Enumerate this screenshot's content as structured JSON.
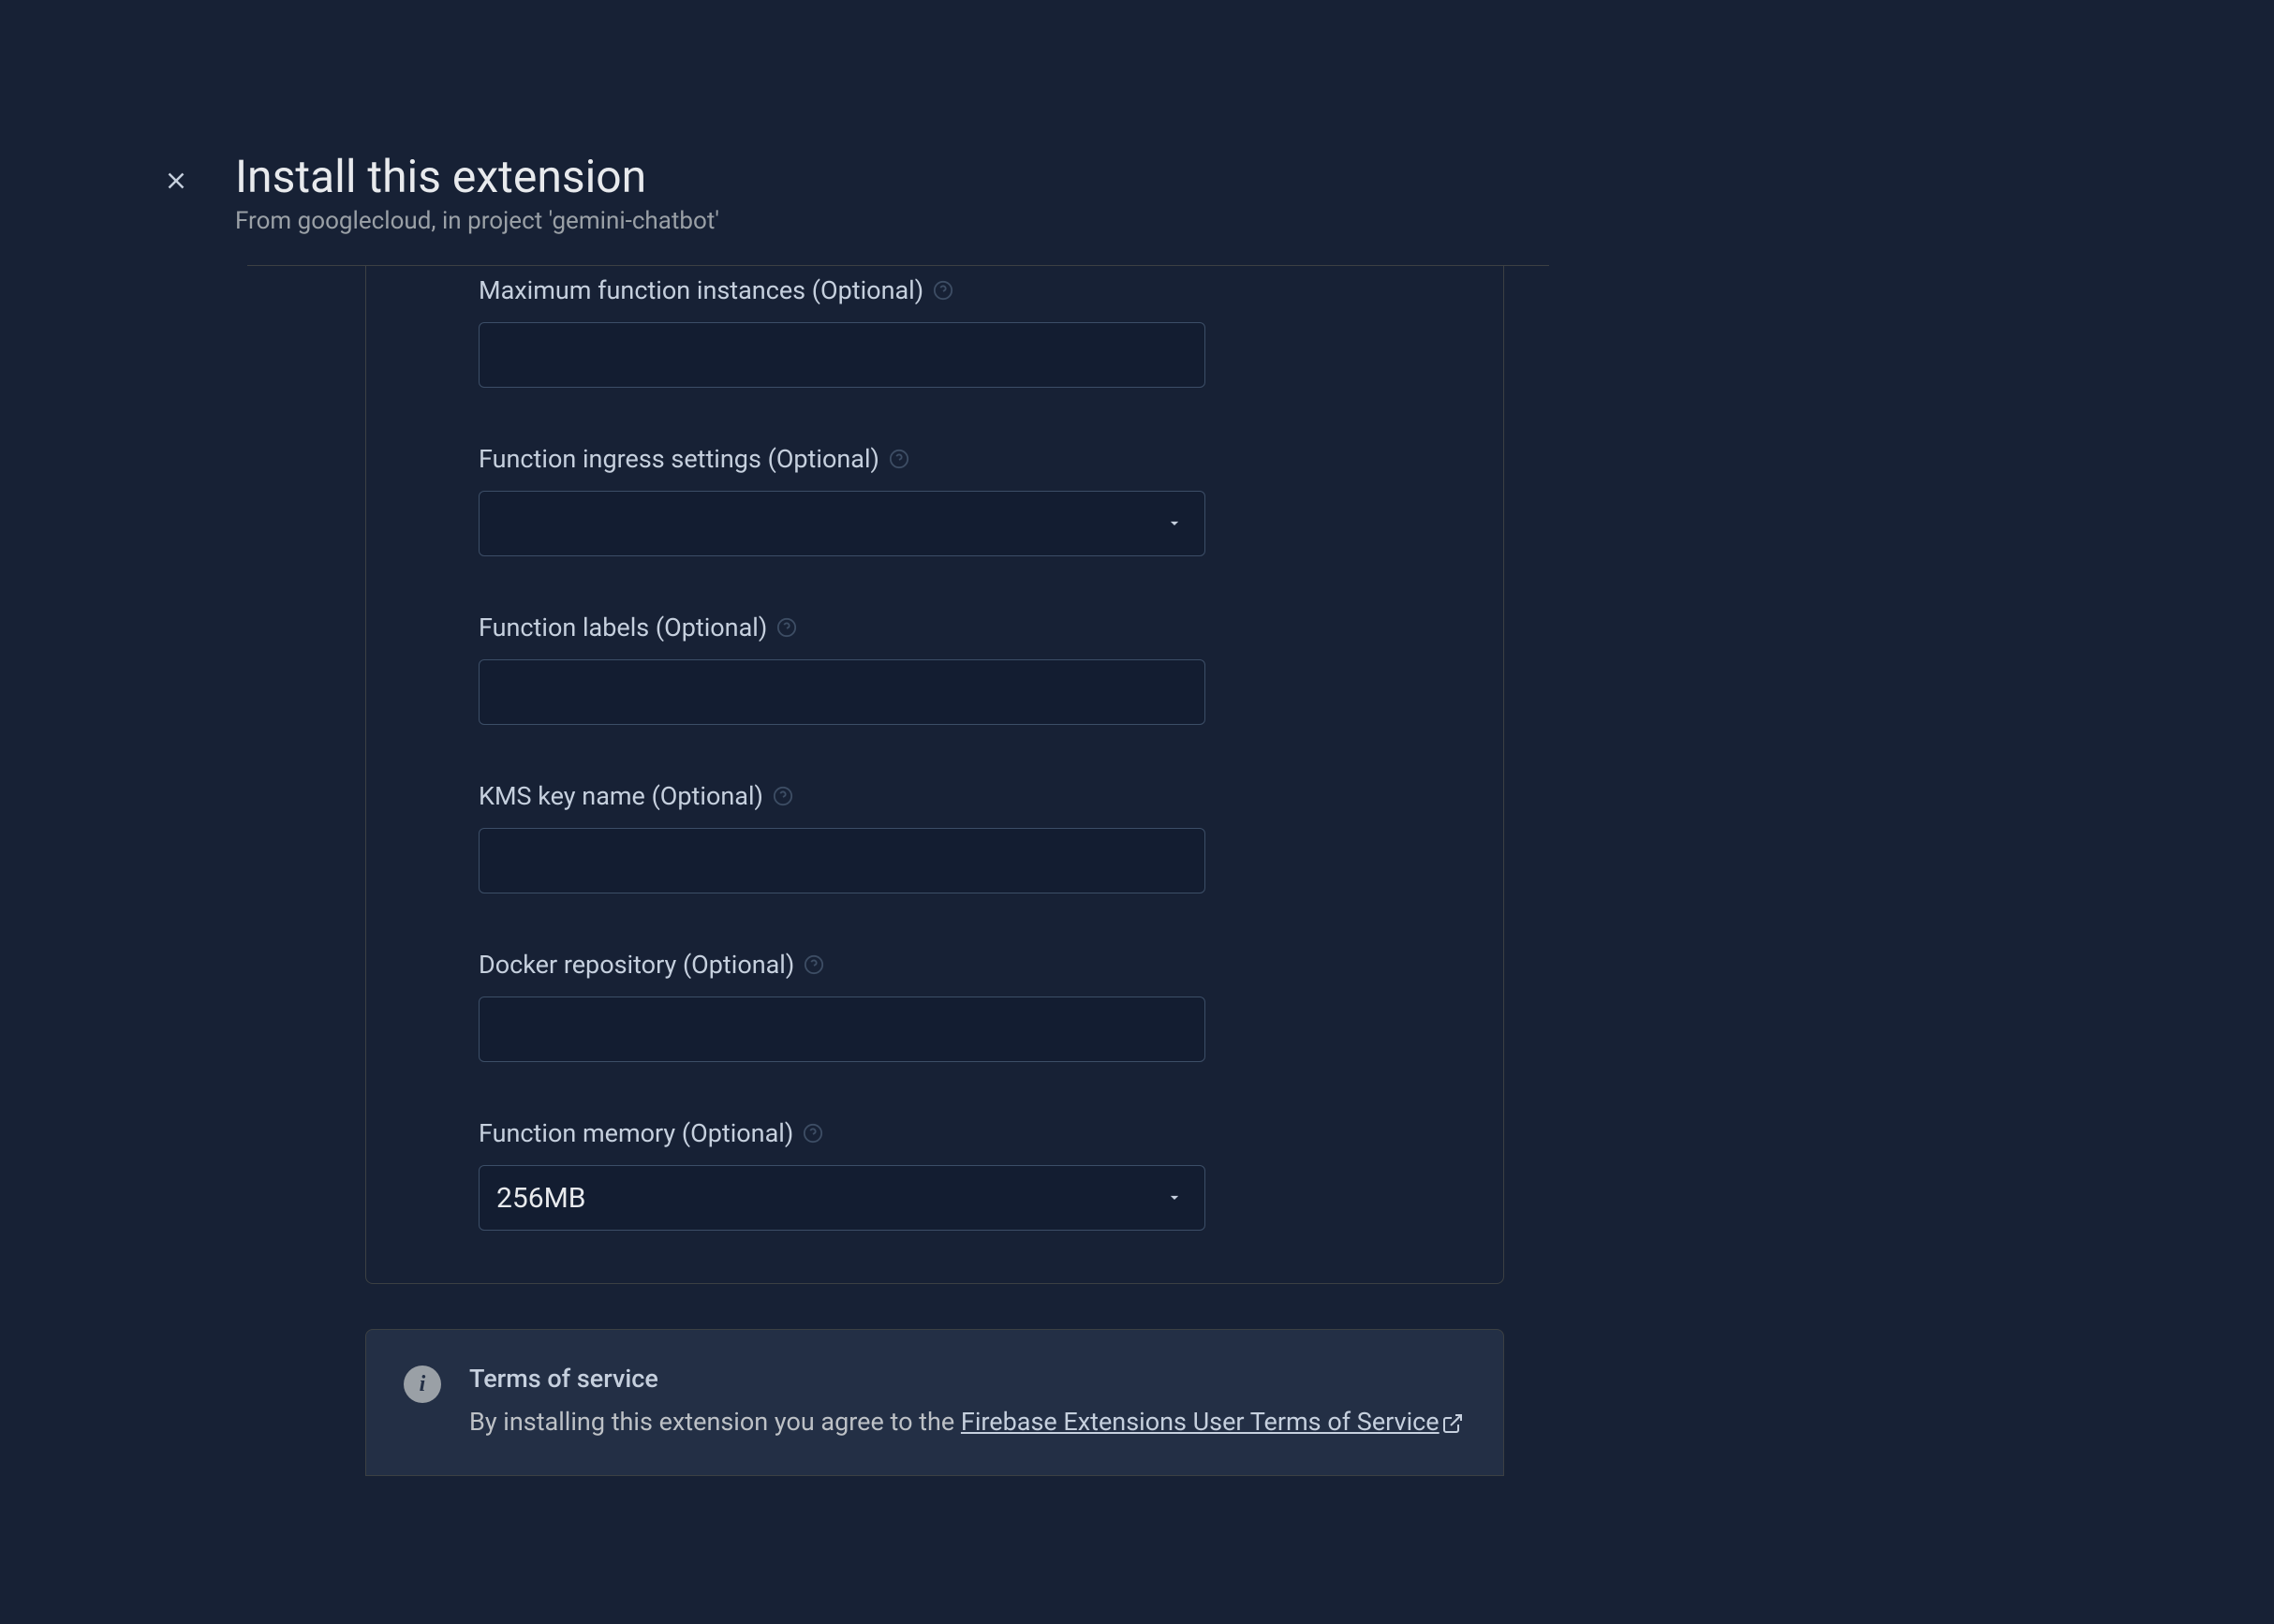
{
  "header": {
    "title": "Install this extension",
    "subtitle": "From googlecloud, in project 'gemini-chatbot'"
  },
  "fields": {
    "maxInstances": {
      "label": "Maximum function instances (Optional)",
      "value": ""
    },
    "ingress": {
      "label": "Function ingress settings (Optional)",
      "value": ""
    },
    "labels": {
      "label": "Function labels (Optional)",
      "value": ""
    },
    "kms": {
      "label": "KMS key name (Optional)",
      "value": ""
    },
    "docker": {
      "label": "Docker repository (Optional)",
      "value": ""
    },
    "memory": {
      "label": "Function memory (Optional)",
      "value": "256MB"
    }
  },
  "terms": {
    "title": "Terms of service",
    "prefix": "By installing this extension you agree to the ",
    "linkText": "Firebase Extensions User Terms of Service"
  }
}
